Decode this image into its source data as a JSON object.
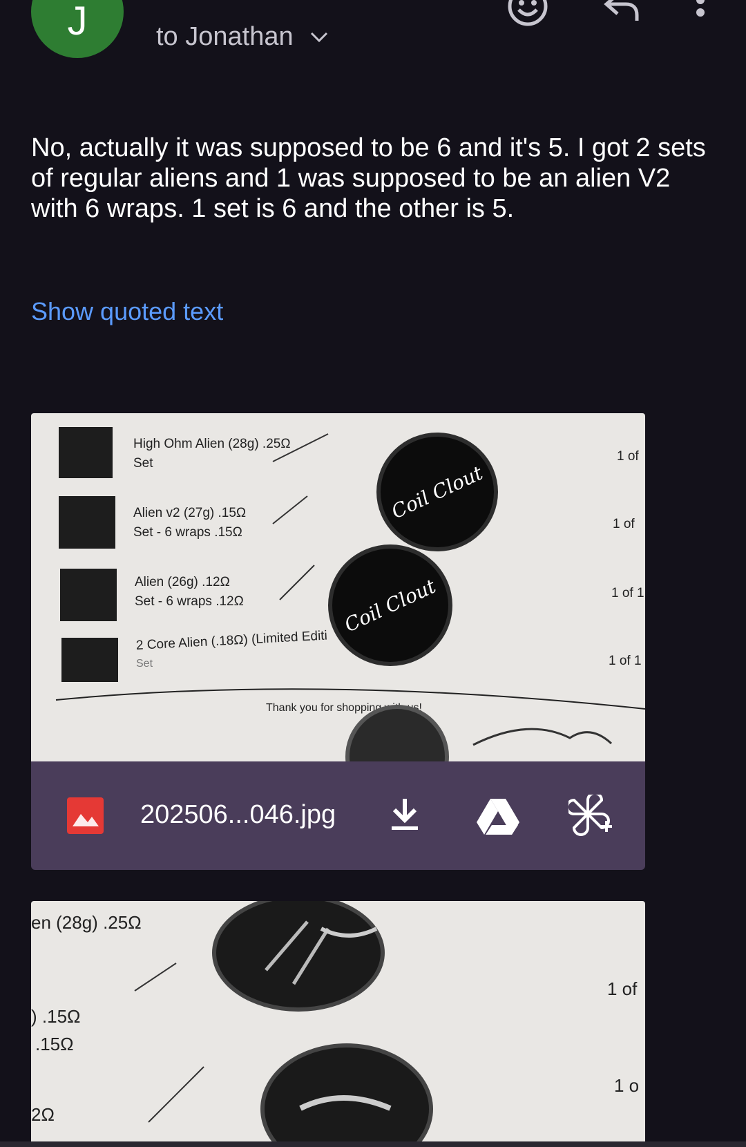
{
  "header": {
    "avatar_initial": "J",
    "recipient_text": "to Jonathan"
  },
  "message": {
    "body": "No, actually it was supposed to be 6 and it's 5. I got 2 sets of regular aliens and 1 was supposed to be an alien V2 with 6 wraps. 1 set is 6 and the other is 5.",
    "show_quoted_label": "Show quoted text"
  },
  "attachment1": {
    "filename": "202506...046.jpg",
    "photo": {
      "lines": [
        "High Ohm Alien (28g) .25Ω",
        "Set",
        "Alien v2 (27g) .15Ω",
        "Set - 6 wraps .15Ω",
        "Alien (26g) .12Ω",
        "Set - 6 wraps .12Ω",
        "2 Core Alien (.18Ω) (Limited Editi",
        "Set",
        "Thank you for shopping with us!"
      ],
      "qty": [
        "1 of",
        "1 of",
        "1 of 1",
        "1 of 1"
      ],
      "jar_brand": "Coil Clout"
    }
  },
  "attachment2": {
    "photo": {
      "lines": [
        "en (28g) .25Ω",
        ") .15Ω",
        ".15Ω",
        "2Ω"
      ],
      "qty": [
        "1 of",
        "1 o"
      ]
    }
  },
  "colors": {
    "background": "#13111a",
    "avatar": "#2e7d32",
    "link": "#5b9bff",
    "attachment_bar": "#4a3d5a",
    "image_icon": "#e53935"
  },
  "icons": [
    "emoji-icon",
    "reply-icon",
    "more-vert-icon",
    "chevron-down-icon",
    "image-icon",
    "download-icon",
    "drive-icon",
    "photos-add-icon"
  ]
}
